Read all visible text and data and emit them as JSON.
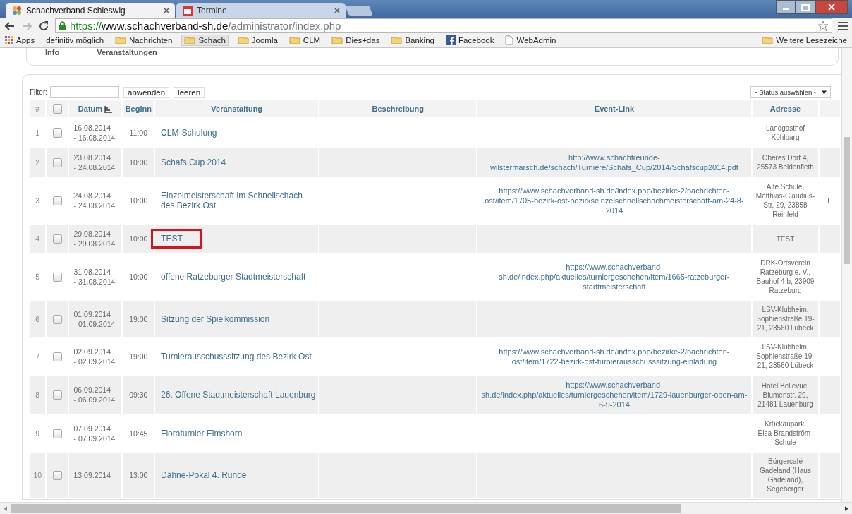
{
  "browser": {
    "tabs": [
      {
        "title": "Schachverband Schleswig",
        "selected": true
      },
      {
        "title": "Termine",
        "selected": false
      }
    ],
    "address": {
      "scheme": "https://",
      "host": "www.schachverband-sh.de",
      "path": "/administrator/index.php"
    },
    "bookmarks": [
      {
        "kind": "apps",
        "label": "Apps"
      },
      {
        "kind": "plain",
        "label": "definitiv möglich"
      },
      {
        "kind": "folder",
        "label": "Nachrichten",
        "selected": false
      },
      {
        "kind": "folder",
        "label": "Schach",
        "selected": true
      },
      {
        "kind": "folder",
        "label": "Joomla",
        "selected": false
      },
      {
        "kind": "folder",
        "label": "CLM",
        "selected": false
      },
      {
        "kind": "folder",
        "label": "Dies+das",
        "selected": false
      },
      {
        "kind": "folder",
        "label": "Banking",
        "selected": false
      },
      {
        "kind": "facebook",
        "label": "Facebook"
      },
      {
        "kind": "page",
        "label": "WebAdmin"
      }
    ],
    "other_bookmarks": "Weitere Lesezeiche"
  },
  "page_tabs": [
    "Info",
    "Veranstaltungen"
  ],
  "filter": {
    "label": "Filter:",
    "apply": "anwenden",
    "clear": "leeren",
    "status": "- Status auswählen -"
  },
  "table": {
    "columns": [
      {
        "label": "#",
        "sorted": false
      },
      {
        "kind": "checkbox",
        "checked": false
      },
      {
        "label": "Datum",
        "sorted": true
      },
      {
        "label": "Beginn",
        "sorted": false
      },
      {
        "label": "Veranstaltung",
        "sorted": false
      },
      {
        "label": "Beschreibung",
        "sorted": false
      },
      {
        "label": "Event-Link",
        "sorted": false
      },
      {
        "label": "Adresse",
        "sorted": false
      }
    ],
    "rows": [
      {
        "num": "1",
        "checked": false,
        "date": [
          "16.08.2014",
          "- 16.08.2014"
        ],
        "start": "11:00",
        "event": "CLM-Schulung",
        "highlighted": false,
        "address": "Landgasthof Köhlbarg"
      },
      {
        "num": "2",
        "checked": false,
        "date": [
          "23.08.2014",
          "- 24.08.2014"
        ],
        "start": "10:00",
        "event": "Schafs Cup 2014",
        "highlighted": false,
        "link": "http://www.schachfreunde-wilstermarsch.de/schach/Turniere/Schafs_Cup/2014/Schafscup2014.pdf",
        "address": "Oberes Dorf 4, 25573 Beidenfleth"
      },
      {
        "num": "3",
        "checked": false,
        "date": [
          "24.08.2014",
          "- 24.08.2014"
        ],
        "start": "10:00",
        "event": "Einzelmeisterschaft im Schnellschach des Bezirk Ost",
        "highlighted": false,
        "link": "https://www.schachverband-sh.de/index.php/bezirke-2/nachrichten-ost/item/1705-bezirk-ost-bezirkseinzelschnellschachmeisterschaft-am-24-8-2014",
        "address": "Alte Schule, Matthias-Claudius-Str. 29, 23858 Reinfeld",
        "column_9": "E"
      },
      {
        "num": "4",
        "checked": false,
        "date": [
          "29.08.2014",
          "- 29.08.2014"
        ],
        "start": "10:00",
        "event": "TEST",
        "highlighted": true,
        "address": "TEST"
      },
      {
        "num": "5",
        "checked": false,
        "date": [
          "31.08.2014",
          "- 31.08.2014"
        ],
        "start": "10:00",
        "event": "offene Ratzeburger Stadtmeisterschaft",
        "highlighted": false,
        "link": "https://www.schachverband-sh.de/index.php/aktuelles/turniergeschehen/item/1665-ratzeburger-stadtmeisterschaft",
        "address": "DRK-Ortsverein Ratzeburg e. V., Bauhof 4 b, 23909 Ratzeburg"
      },
      {
        "num": "6",
        "checked": false,
        "date": [
          "01.09.2014",
          "- 01.09.2014"
        ],
        "start": "19:00",
        "event": "Sitzung der Spielkommission",
        "highlighted": false,
        "address": "LSV-Klubheim, Sophienstraße 19-21, 23560 Lübeck"
      },
      {
        "num": "7",
        "checked": false,
        "date": [
          "02.09.2014",
          "- 02.09.2014"
        ],
        "start": "19:00",
        "event": "Turnierausschusssitzung des Bezirk Ost",
        "highlighted": false,
        "link": "https://www.schachverband-sh.de/index.php/bezirke-2/nachrichten-ost/item/1722-bezirk-ost-turnierausschusssitzung-einladung",
        "address": "LSV-Klubheim, Sophienstraße 19-21, 23560 Lübeck"
      },
      {
        "num": "8",
        "checked": false,
        "date": [
          "06.09.2014",
          "- 06.09.2014"
        ],
        "start": "09:30",
        "event": "26. Offene Stadtmeisterschaft Lauenburg",
        "highlighted": false,
        "link": "https://www.schachverband-sh.de/index.php/aktuelles/turniergeschehen/item/1729-lauenburger-open-am-6-9-2014",
        "address": "Hotel Bellevue, Blumenstr. 29, 21481 Lauenburg"
      },
      {
        "num": "9",
        "checked": false,
        "date": [
          "07.09.2014",
          "- 07.09.2014"
        ],
        "start": "10:45",
        "event": "Floraturnier Elmshorn",
        "highlighted": false,
        "address": "Krückaupark, Elsa-Brandström-Schule"
      },
      {
        "num": "10",
        "checked": false,
        "date": [
          "13.09.2014"
        ],
        "start": "13:00",
        "event": "Dähne-Pokal 4. Runde",
        "highlighted": false,
        "address": "Bürgercafé Gadeland (Haus Gadeland), Segeberger"
      }
    ]
  }
}
